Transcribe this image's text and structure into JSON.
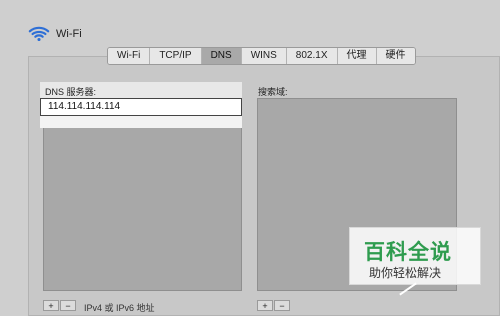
{
  "header": {
    "title": "Wi-Fi",
    "icon": "wifi-icon"
  },
  "tabs": [
    {
      "label": "Wi-Fi"
    },
    {
      "label": "TCP/IP"
    },
    {
      "label": "DNS",
      "active": true
    },
    {
      "label": "WINS"
    },
    {
      "label": "802.1X"
    },
    {
      "label": "代理"
    },
    {
      "label": "硬件"
    }
  ],
  "dns": {
    "label": "DNS 服务器:",
    "servers": [
      "114.114.114.114"
    ]
  },
  "search": {
    "label": "搜索域:"
  },
  "bottom": {
    "note": "IPv4 或 IPv6 地址",
    "left_buttons": [
      "+",
      "−"
    ],
    "right_buttons": [
      "+",
      "−"
    ]
  },
  "watermark": {
    "title": "百科全说",
    "subtitle": "助你轻松解决"
  },
  "colors": {
    "wifi_blue": "#2e6fd6",
    "watermark_green": "#2f9c4f"
  }
}
